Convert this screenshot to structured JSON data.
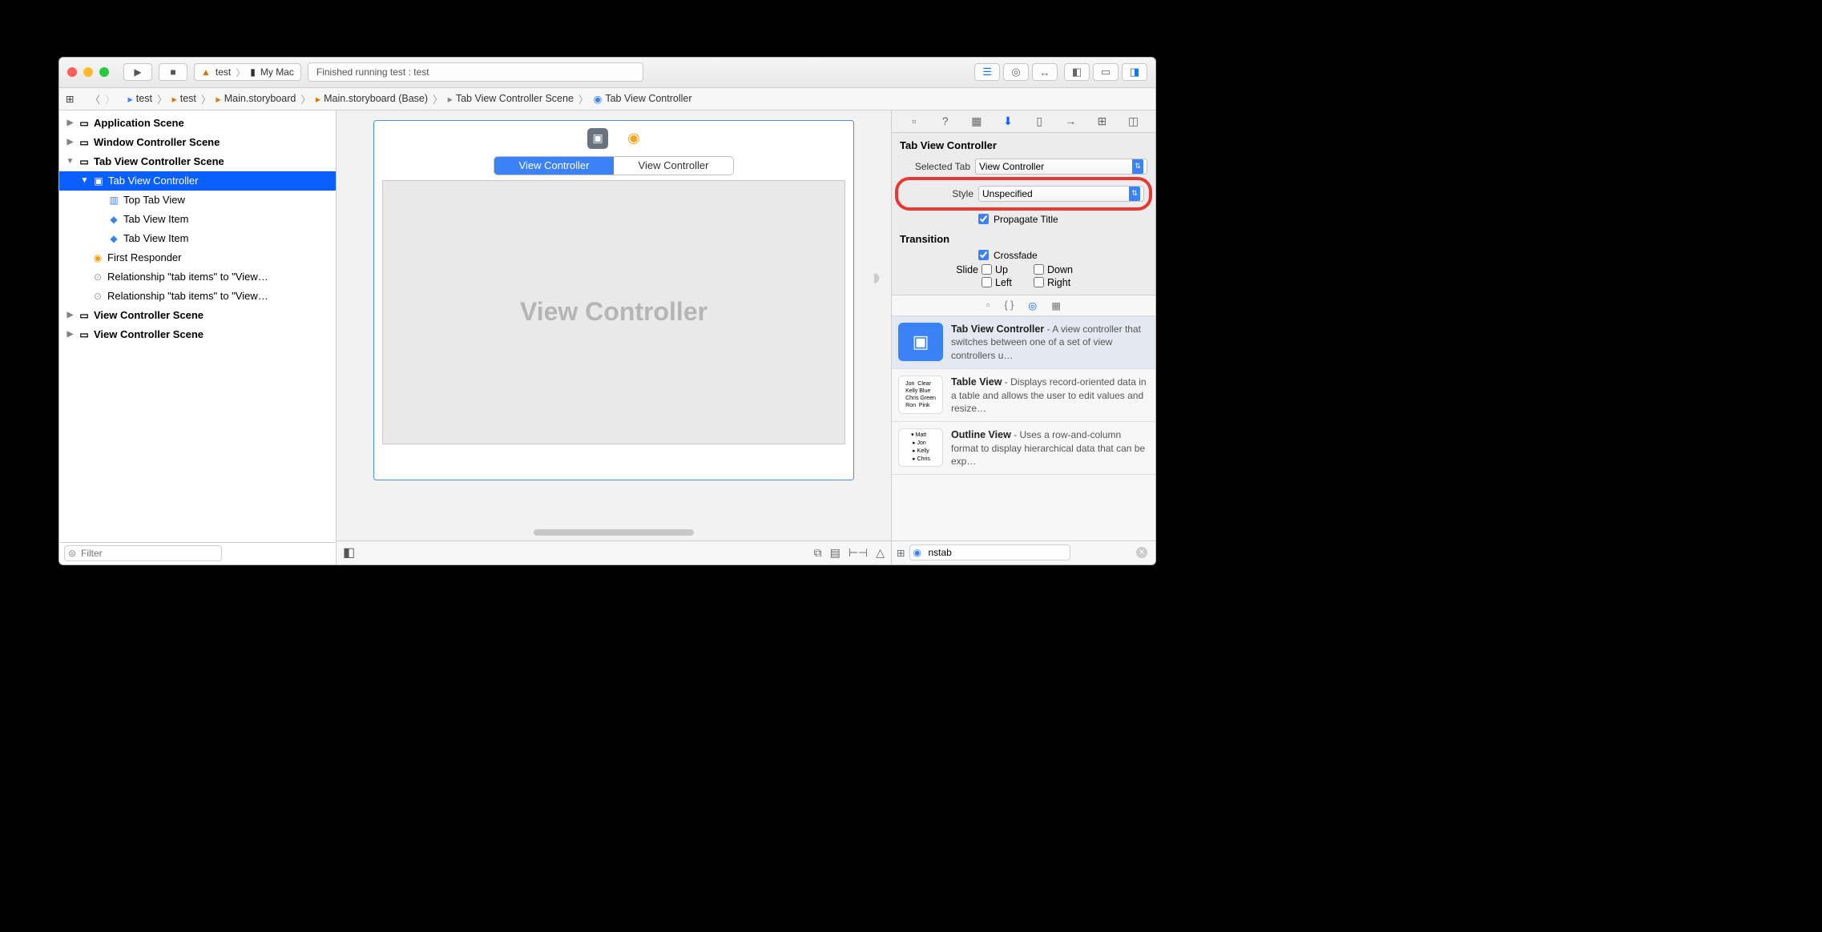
{
  "toolbar": {
    "scheme_app": "test",
    "scheme_dest": "My Mac",
    "status": "Finished running test : test"
  },
  "jumpbar": {
    "items": [
      "test",
      "test",
      "Main.storyboard",
      "Main.storyboard (Base)",
      "Tab View Controller Scene",
      "Tab View Controller"
    ]
  },
  "navigator": {
    "scenes": [
      {
        "label": "Application Scene",
        "expanded": false
      },
      {
        "label": "Window Controller Scene",
        "expanded": false
      },
      {
        "label": "Tab View Controller Scene",
        "expanded": true,
        "children": [
          {
            "label": "Tab View Controller",
            "selected": true,
            "expanded": true,
            "children": [
              {
                "label": "Top Tab View"
              },
              {
                "label": "Tab View Item"
              },
              {
                "label": "Tab View Item"
              }
            ]
          },
          {
            "label": "First Responder"
          },
          {
            "label": "Relationship \"tab items\" to \"View…"
          },
          {
            "label": "Relationship \"tab items\" to \"View…"
          }
        ]
      },
      {
        "label": "View Controller Scene",
        "expanded": false
      },
      {
        "label": "View Controller Scene",
        "expanded": false
      }
    ],
    "filter_placeholder": "Filter"
  },
  "canvas": {
    "tabs": [
      "View Controller",
      "View Controller"
    ],
    "content_title": "View Controller"
  },
  "inspector": {
    "title": "Tab View Controller",
    "selected_tab_label": "Selected Tab",
    "selected_tab_value": "View Controller",
    "style_label": "Style",
    "style_value": "Unspecified",
    "propagate_title": "Propagate Title",
    "transition_title": "Transition",
    "crossfade": "Crossfade",
    "slide_label": "Slide",
    "slide_opts": [
      "Up",
      "Down",
      "Left",
      "Right"
    ]
  },
  "library": {
    "items": [
      {
        "name": "Tab View Controller",
        "desc": " - A view controller that switches between one of a set of view controllers u…"
      },
      {
        "name": "Table View",
        "desc": " - Displays record-oriented data in a table and allows the user to edit values and resize…"
      },
      {
        "name": "Outline View",
        "desc": " - Uses a row-and-column format to display hierarchical data that can be exp…"
      }
    ],
    "filter_value": "nstab"
  }
}
